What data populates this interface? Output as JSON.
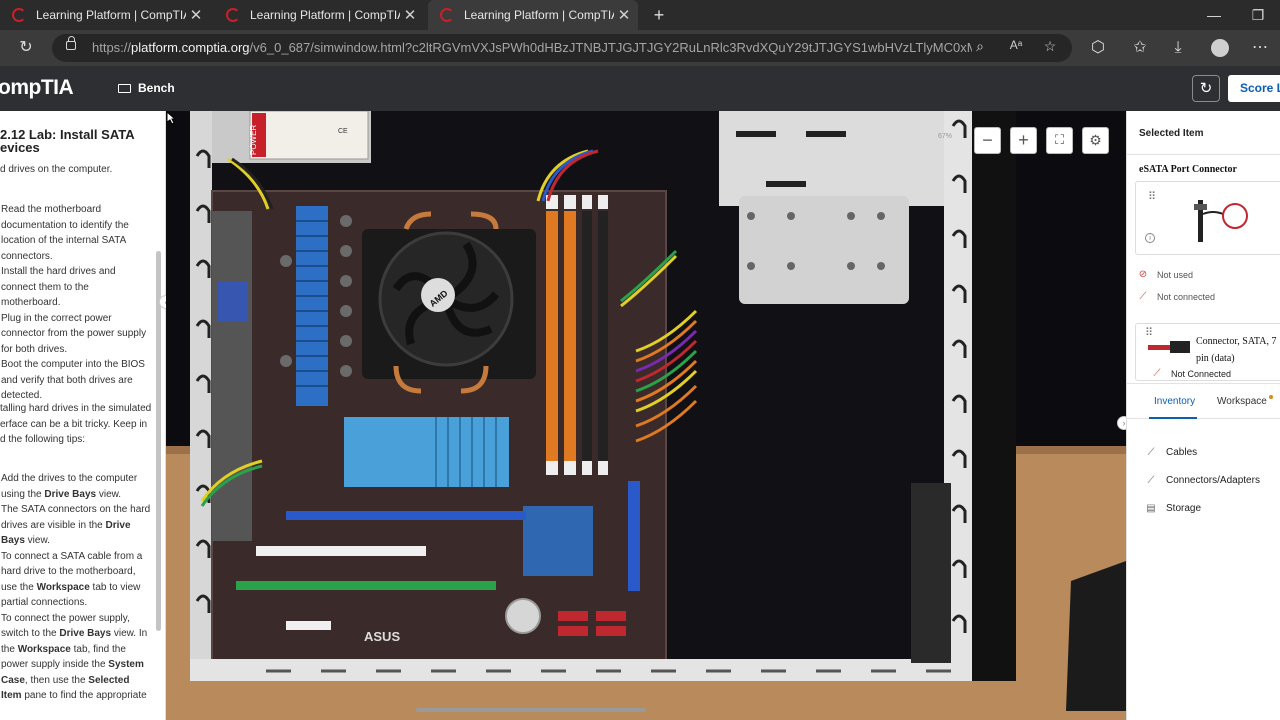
{
  "browser": {
    "tabs": [
      {
        "title": "Learning Platform | CompTIA"
      },
      {
        "title": "Learning Platform | CompTIA"
      },
      {
        "title": "Learning Platform | CompTIA"
      }
    ],
    "new_tab": "+",
    "window_controls": {
      "minimize": "—",
      "restore": "❐"
    },
    "url_prefix": "https://",
    "url_host": "platform.comptia.org",
    "url_path": "/v6_0_687/simwindow.html?c2ltRGVmVXJsPWh0dHBzJTNBJTJGJTJGY2RuLnRlc3RvdXQuY29tJTJGYS1wbHVzLTlyMC0xMjB4LWVuL..."
  },
  "app": {
    "logo": "ompTIA",
    "bench_label": "Bench",
    "score_label": "Score La"
  },
  "instructions": {
    "title": "2.12 Lab: Install SATA evices",
    "subtitle": "d drives on the computer.",
    "steps": [
      "Read the motherboard documentation to identify the location of the internal SATA connectors.",
      "Install the hard drives and connect them to the motherboard.",
      "Plug in the correct power connector from the power supply for both drives.",
      "Boot the computer into the BIOS and verify that both drives are detected."
    ],
    "tips_intro": "talling hard drives in the simulated erface can be a bit tricky. Keep in d the following tips:",
    "tips": {
      "t1_a": "Add the drives to the computer using the ",
      "t1_b": "Drive Bays",
      "t1_c": " view.",
      "t2_a": "The SATA connectors on the hard drives are visible in the ",
      "t2_b": "Drive Bays",
      "t2_c": " view.",
      "t3_a": "To connect a SATA cable from a hard drive to the motherboard, use the ",
      "t3_b": "Workspace",
      "t3_c": " tab to view partial connections.",
      "t4_a": "To connect the power supply, switch to the ",
      "t4_b": "Drive Bays",
      "t4_c": " view. In the ",
      "t4_d": "Workspace",
      "t4_e": " tab, find the power supply inside the ",
      "t4_f": "System Case",
      "t4_g": ", then use the ",
      "t4_h": "Selected Item",
      "t4_i": " pane to find the appropriate"
    }
  },
  "simulation": {
    "zoom_level": "67%",
    "zoom_out": "−",
    "zoom_in": "+",
    "fullscreen": "⛶",
    "settings": "⚙",
    "psu_label": "POWER",
    "psu_marks": "CE",
    "cpu_fan_brand": "AMD",
    "board_brand": "ASUS",
    "collapse_left": "‹",
    "collapse_right": "›"
  },
  "selected_item": {
    "header": "Selected Item",
    "name": "eSATA Port Connector",
    "status_used": "Not used",
    "status_connected": "Not connected",
    "connector_name": "Connector, SATA, 7 pin (data)",
    "connector_status": "Not Connected"
  },
  "panel_tabs": {
    "inventory": "Inventory",
    "workspace": "Workspace"
  },
  "inventory": {
    "items": [
      {
        "label": "Cables"
      },
      {
        "label": "Connectors/Adapters"
      },
      {
        "label": "Storage"
      }
    ]
  }
}
